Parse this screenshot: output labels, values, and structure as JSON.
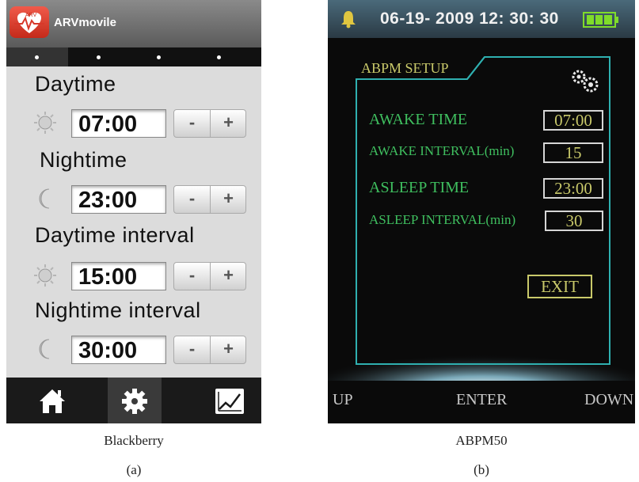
{
  "panel_a": {
    "app_name": "ARVmovile",
    "logo_text": "ARV",
    "sections": [
      {
        "title": "Daytime",
        "icon": "sun-icon",
        "value": "07:00"
      },
      {
        "title": "Nightime",
        "icon": "moon-icon",
        "value": "23:00"
      },
      {
        "title": "Daytime interval",
        "icon": "sun-icon",
        "value": "15:00"
      },
      {
        "title": "Nightime interval",
        "icon": "moon-icon",
        "value": "30:00"
      }
    ],
    "stepper": {
      "minus": "-",
      "plus": "+"
    },
    "nav": [
      "home-icon",
      "gear-icon",
      "chart-icon"
    ],
    "caption": "Blackberry",
    "label": "(a)"
  },
  "panel_b": {
    "datetime": "06-19- 2009 12: 30: 30",
    "title": "ABPM SETUP",
    "rows": [
      {
        "label": "AWAKE TIME",
        "value": "07:00"
      },
      {
        "label": "AWAKE INTERVAL(min)",
        "value": "15"
      },
      {
        "label": "ASLEEP TIME",
        "value": "23:00"
      },
      {
        "label": "ASLEEP INTERVAL(min)",
        "value": "30"
      }
    ],
    "exit": "EXIT",
    "softkeys": {
      "up": "UP",
      "enter": "ENTER",
      "down": "DOWN"
    },
    "caption": "ABPM50",
    "label": "(b)"
  },
  "colors": {
    "device_label_green": "#3fbf5f",
    "device_value_yellow": "#c9c96a",
    "device_frame_teal": "#2fb0b0",
    "battery_green": "#7fdc2a",
    "logo_red": "#d8382a"
  }
}
